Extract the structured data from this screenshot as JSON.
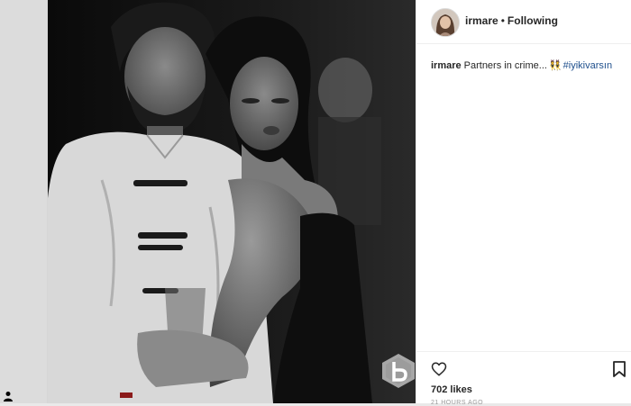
{
  "post": {
    "username": "irmare",
    "separator": "•",
    "follow_status": "Following",
    "caption": {
      "username": "irmare",
      "text": "Partners in crime...",
      "emoji": "👯",
      "hashtag": "#iyikivarsın"
    },
    "likes": "702 likes",
    "timestamp": "21 HOURS AGO"
  },
  "icons": {
    "like": "heart-icon",
    "save": "bookmark-icon",
    "gutter": "user-icon",
    "watermark": "b-logo-watermark"
  },
  "colors": {
    "hashtag": "#1e4f8c",
    "text": "#262626",
    "photo_background": "#050505"
  }
}
